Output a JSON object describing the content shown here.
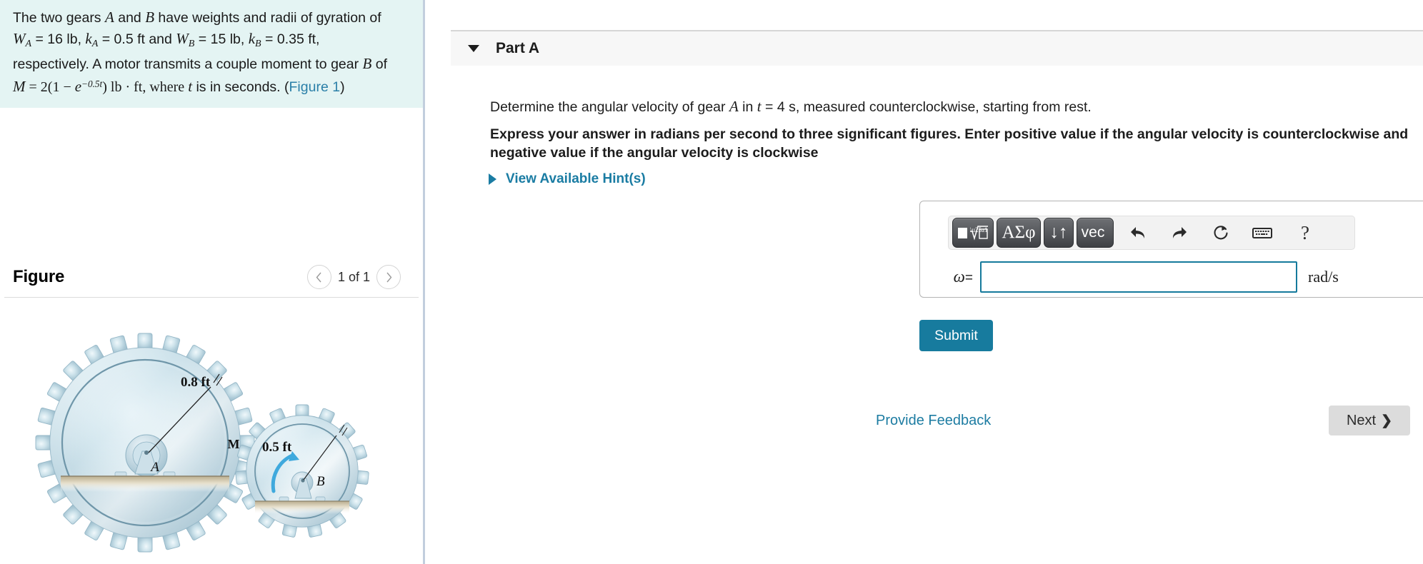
{
  "problem": {
    "line1_a": "The two gears ",
    "var_A": "A",
    "line1_b": " and ",
    "var_B": "B",
    "line1_c": " have weights and radii of gyration of",
    "W_A": "W",
    "sub_A": "A",
    "eq1": " = 16 lb, ",
    "k_A": "k",
    "sub_A2": "A",
    "eq2": " = 0.5 ft and ",
    "W_B": "W",
    "sub_B": "B",
    "eq3": " = 15 lb, ",
    "k_B": "k",
    "sub_B2": "B",
    "eq4": " = 0.35 ft,",
    "line3": "respectively. A motor transmits a couple moment to gear ",
    "var_B2": "B",
    "line3_end": " of",
    "M": "M",
    "equals": " = 2(1 − ",
    "e": "e",
    "exp": "−0.5t",
    "close": ") lb · ft, where ",
    "t": "t",
    "tail": " is in seconds. (",
    "figure_link": "Figure 1",
    "tail2": ")"
  },
  "figure": {
    "title": "Figure",
    "prev_icon": "chevron-left-icon",
    "next_icon": "chevron-right-icon",
    "counter": "1 of 1",
    "gear_a": {
      "center_label": "A",
      "radius_label": "0.8 ft"
    },
    "gear_b": {
      "center_label": "B",
      "radius_label": "0.5 ft",
      "moment_label": "M"
    }
  },
  "part": {
    "caret_icon": "caret-down-icon",
    "label": "Part A",
    "question_a": "Determine the angular velocity of gear ",
    "question_var": "A",
    "question_b": " in ",
    "question_t": "t",
    "question_c": " = 4 s, measured counterclockwise, starting from rest.",
    "instruction": "Express your answer in radians per second to three significant figures. Enter positive value if the angular velocity is counterclockwise and negative value if the angular velocity is clockwise",
    "hints_icon": "caret-right-icon",
    "hints_label": "View Available Hint(s)"
  },
  "toolbar": {
    "buttons": [
      {
        "name": "template-sqrt-button",
        "label": "■√□"
      },
      {
        "name": "greek-symbols-button",
        "label": "ΑΣφ"
      },
      {
        "name": "updown-arrows-button",
        "label": "↓↑"
      },
      {
        "name": "vector-button",
        "label": "vec"
      }
    ],
    "icons": [
      {
        "name": "undo-icon",
        "label": "undo"
      },
      {
        "name": "redo-icon",
        "label": "redo"
      },
      {
        "name": "reset-icon",
        "label": "reset"
      },
      {
        "name": "keyboard-icon",
        "label": "keyboard"
      },
      {
        "name": "help-icon",
        "label": "?"
      }
    ]
  },
  "answer": {
    "variable": "ω",
    "equals": "=",
    "value": "",
    "placeholder": "",
    "unit": "rad/s"
  },
  "actions": {
    "submit_label": "Submit",
    "feedback_label": "Provide Feedback",
    "next_label": "Next",
    "next_chevron": "❯"
  },
  "colors": {
    "accent_teal": "#177b9e",
    "link_blue": "#1d7ca2",
    "problem_bg": "#e4f4f3",
    "input_border": "#157a9c",
    "moment_arrow": "#3fa9dd"
  }
}
